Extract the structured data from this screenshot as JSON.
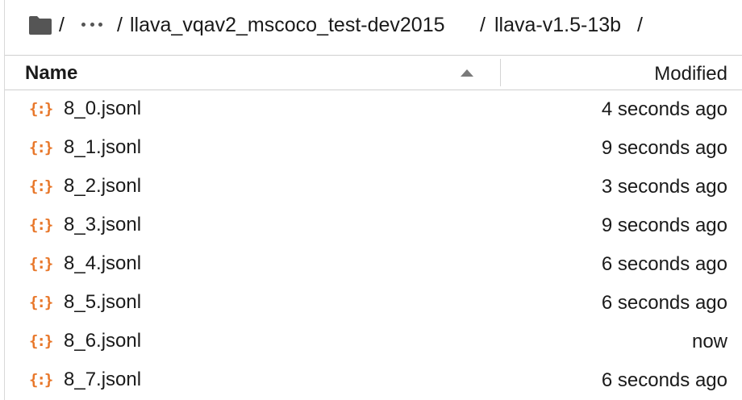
{
  "breadcrumb": {
    "root_icon": "folder-icon",
    "separator": "/",
    "ellipsis_icon": "ellipsis-icon",
    "segments": [
      "llava_vqav2_mscoco_test-dev2015",
      "llava-v1.5-13b"
    ]
  },
  "header": {
    "name_label": "Name",
    "modified_label": "Modified",
    "sort_icon": "sort-ascending-icon"
  },
  "files": [
    {
      "icon": "json-file-icon",
      "name": "8_0.jsonl",
      "modified": "4 seconds ago"
    },
    {
      "icon": "json-file-icon",
      "name": "8_1.jsonl",
      "modified": "9 seconds ago"
    },
    {
      "icon": "json-file-icon",
      "name": "8_2.jsonl",
      "modified": "3 seconds ago"
    },
    {
      "icon": "json-file-icon",
      "name": "8_3.jsonl",
      "modified": "9 seconds ago"
    },
    {
      "icon": "json-file-icon",
      "name": "8_4.jsonl",
      "modified": "6 seconds ago"
    },
    {
      "icon": "json-file-icon",
      "name": "8_5.jsonl",
      "modified": "6 seconds ago"
    },
    {
      "icon": "json-file-icon",
      "name": "8_6.jsonl",
      "modified": "now"
    },
    {
      "icon": "json-file-icon",
      "name": "8_7.jsonl",
      "modified": "6 seconds ago"
    }
  ],
  "colors": {
    "json_icon": "#e8772a",
    "text": "#1a1a1a",
    "border": "#cfcfcf"
  }
}
